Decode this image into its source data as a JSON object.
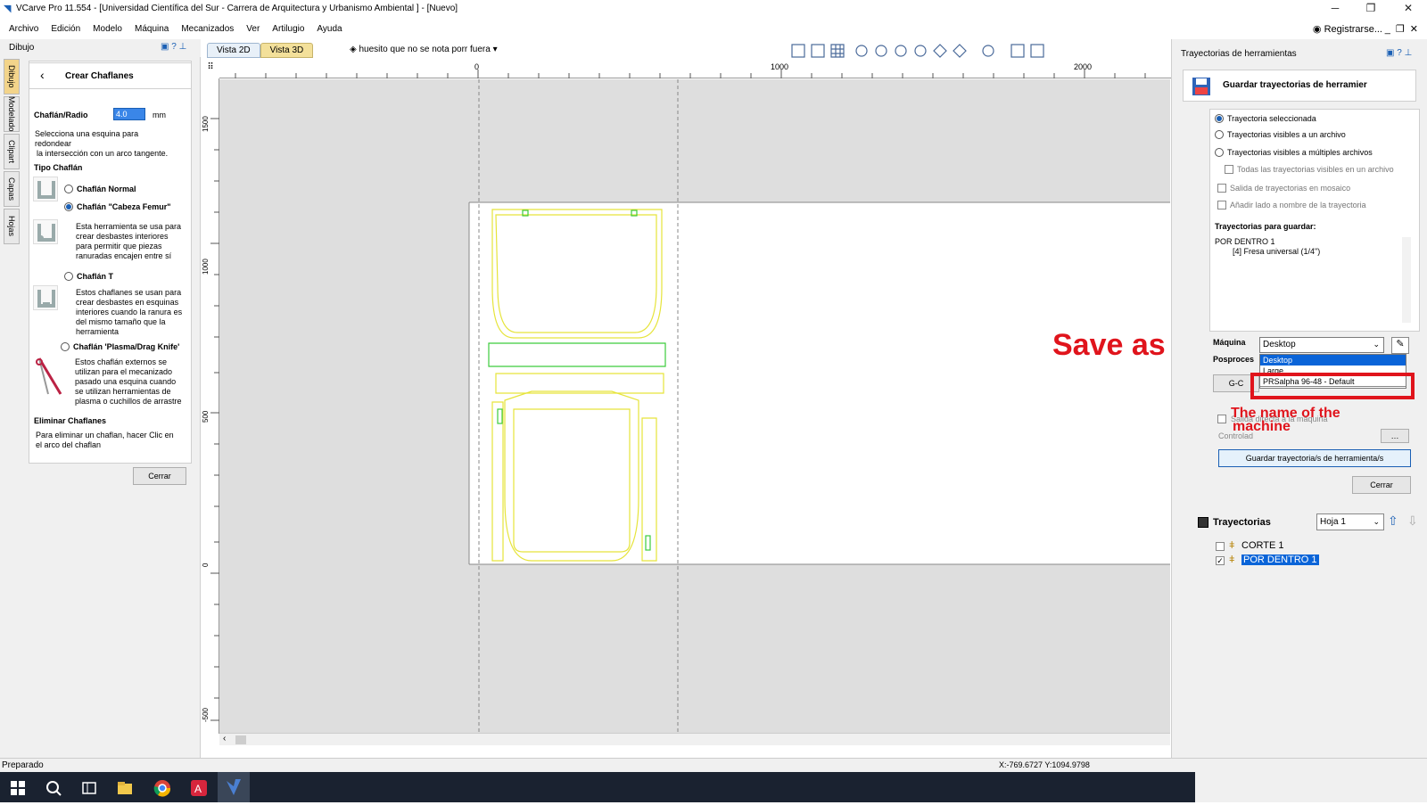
{
  "window": {
    "title": "VCarve Pro 11.554 - [Universidad Científica del Sur - Carrera de Arquitectura y Urbanismo Ambiental ] - [Nuevo]",
    "controls": [
      "─",
      "❐",
      "✕"
    ]
  },
  "menu": {
    "items": [
      "Archivo",
      "Edición",
      "Modelo",
      "Máquina",
      "Mecanizados",
      "Ver",
      "Artilugio",
      "Ayuda"
    ],
    "register_label": "Registrarse..."
  },
  "left_panel": {
    "dock_title": "Dibujo",
    "vertical_tabs": [
      "Dibujo",
      "Modelado",
      "Clipart",
      "Capas",
      "Hojas"
    ],
    "form_title": "Crear Chaflanes",
    "radius_label": "Chaflán/Radio",
    "radius_value": "4.0",
    "radius_unit": "mm",
    "instruction": "Selecciona una esquina para redondear",
    "instruction2": "la intersección con un arco tangente.",
    "type_heading": "Tipo Chaflán",
    "options": [
      {
        "label": "Chaflán Normal",
        "selected": false,
        "description": ""
      },
      {
        "label": "Chaflán \"Cabeza Femur\"",
        "selected": true,
        "description": "Esta herramienta se usa para crear desbastes interiores para permitir que piezas ranuradas encajen entre sí"
      },
      {
        "label": "Chaflán T",
        "selected": false,
        "description": "Estos chaflanes se usan para crear desbastes en esquinas interiores cuando la ranura es del mismo tamaño que la herramienta"
      },
      {
        "label": "Chaflán 'Plasma/Drag Knife'",
        "selected": false,
        "description": "Estos chaflán externos se utilizan para el mecanizado pasado una esquina cuando se utilizan herramientas de plasma o cuchillos de arrastre"
      }
    ],
    "remove_heading": "Eliminar Chaflanes",
    "remove_text": "Para eliminar un chaflan, hacer Clic en el arco del chaflan",
    "close_button": "Cerrar"
  },
  "view_tabs": [
    "Vista 2D",
    "Vista 3D"
  ],
  "layer_select": "huesito que no se nota porr fuera",
  "ruler": {
    "top_ticks": [
      "0",
      "1000",
      "2000"
    ],
    "left_ticks": [
      "1500",
      "1000",
      "500",
      "0",
      "-500"
    ]
  },
  "annotation": {
    "save_as": "Save as",
    "machine_note_line1": "The name of the",
    "machine_note_line2": "machine"
  },
  "right_panel": {
    "dock_title": "Trayectorias de herramientas",
    "header": "Guardar trayectorias de herramier",
    "output_options": [
      {
        "label": "Trayectoria seleccionada",
        "selected": true
      },
      {
        "label": "Trayectorias visibles a un archivo",
        "selected": false
      },
      {
        "label": "Trayectorias visibles a múltiples archivos",
        "selected": false
      }
    ],
    "checkboxes": [
      "Todas las trayectorias visibles en un archivo",
      "Salida de trayectorias en mosaico",
      "Añadir lado a nombre de la trayectoria"
    ],
    "to_save_heading": "Trayectorias para guardar:",
    "to_save_items": [
      "POR DENTRO 1",
      "[4] Fresa universal (1/4\")"
    ],
    "machine_label": "Máquina",
    "machine_value": "Desktop",
    "machine_options": [
      "Desktop",
      "Large",
      "PRSalpha 96-48 - Default"
    ],
    "postprocessor_label": "Posproces",
    "gcode_button": "G-C",
    "output_to_machine": "Salida directa a la máquina",
    "controller_label": "Controlad",
    "save_button": "Guardar trayectoria/s de herramienta/s",
    "close_button": "Cerrar",
    "toolpaths_title": "Trayectorias",
    "sheet_value": "Hoja 1",
    "toolpaths": [
      {
        "name": "CORTE 1",
        "checked": false
      },
      {
        "name": "POR DENTRO 1",
        "checked": true
      }
    ]
  },
  "status": {
    "text": "Preparado",
    "coords": "X:-769.6727 Y:1094.9798"
  }
}
